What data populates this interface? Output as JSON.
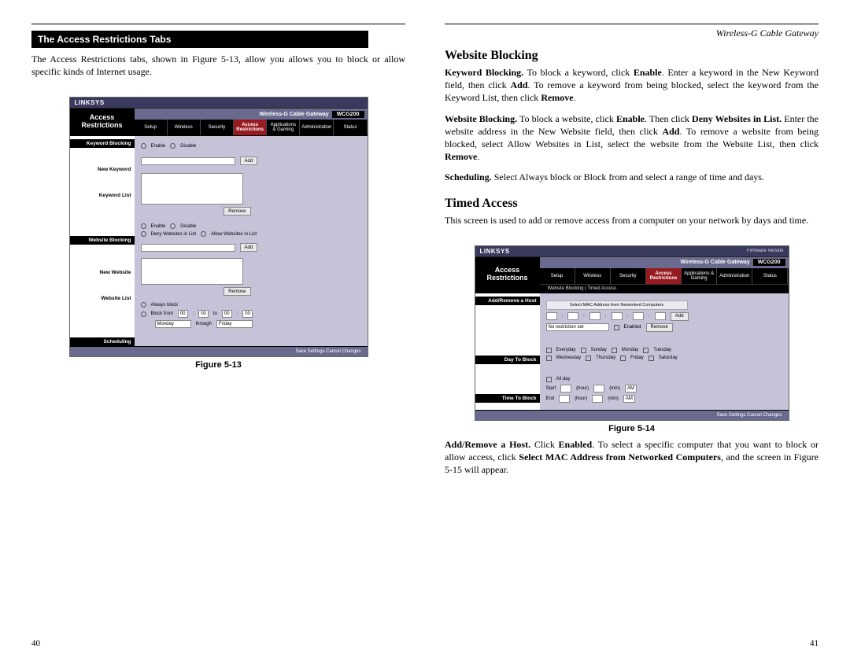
{
  "leftPage": {
    "sectionBar": "The Access Restrictions Tabs",
    "paragraph": "The Access Restrictions tabs, shown in Figure 5-13, allow you allows you to block or allow specific kinds of Internet usage.",
    "figCaption": "Figure 5-13",
    "pageNum": "40"
  },
  "rightPage": {
    "headerRight": "Wireless-G Cable Gateway",
    "h1a": "Website Blocking",
    "p1": "<b>Keyword Blocking.</b> To block a keyword, click <b>Enable</b>.  Enter a keyword in the New Keyword field, then click <b>Add</b>.  To remove a keyword from being blocked, select the keyword from the Keyword List, then click <b>Remove</b>.",
    "p2": "<b>Website Blocking.</b> To block a website, click <b>Enable</b>. Then click <b>Deny Websites in List.</b>  Enter the website address in the New Website field, then click <b>Add</b>. To remove a website from being blocked, select Allow Websites in List, select the website from the Website List, then click <b>Remove</b>.",
    "p3": "<b>Scheduling.</b> Select Always block or Block from and select a range of time and days.",
    "h1b": "Timed Access",
    "p4": "This screen is used to add or remove access from a computer on your network by days and time.",
    "figCaption": "Figure 5-14",
    "p5": "<b>Add/Remove a Host.</b> Click <b>Enabled</b>.  To select a specific computer that you want to block or allow access, click <b>Select MAC Address from Networked Computers</b>, and the screen in Figure 5-15 will appear.",
    "pageNum": "41"
  },
  "shot13": {
    "brand": "LINKSYS",
    "title": "Access Restrictions",
    "prod": "Wireless-G Cable Gateway",
    "model": "WCG200",
    "tabs": [
      "Setup",
      "Wireless",
      "Security",
      "Access Restrictions",
      "Applications & Gaming",
      "Administration",
      "Status"
    ],
    "sideLabels": [
      "Keyword Blocking",
      "New Keyword",
      "Keyword List",
      "Website Blocking",
      "New Website",
      "Website List",
      "Scheduling"
    ],
    "radios": {
      "enable": "Enable",
      "disable": "Disable",
      "deny": "Deny Websites in List",
      "allow": "Allow Websites in List",
      "always": "Always block",
      "blockfrom": "Block from"
    },
    "btnAdd": "Add",
    "btnRemove": "Remove",
    "sched": {
      "from": "Monday",
      "to": "through",
      "end": "Friday"
    },
    "footer": "Save Settings    Cancel Changes"
  },
  "shot14": {
    "brand": "LINKSYS",
    "fw": "Firmware Version",
    "title": "Access Restrictions",
    "prod": "Wireless-G Cable Gateway",
    "model": "WCG200",
    "tabs": [
      "Setup",
      "Wireless",
      "Security",
      "Access Restrictions",
      "Applications & Gaming",
      "Administration",
      "Status"
    ],
    "subtabs": "Website Blocking   |   Timed Access",
    "sideLabels": [
      "Add/Remove a Host",
      "Day To Block",
      "Time To Block"
    ],
    "msg": "Select MAC Address from Networked Computers",
    "btnAdd": "Add",
    "btnEnabled": "Enabled",
    "btnRemove": "Remove",
    "noRestrict": "No restriction set",
    "days": [
      "Everyday",
      "Sunday",
      "Monday",
      "Tuesday",
      "Wednesday",
      "Thursday",
      "Friday",
      "Saturday"
    ],
    "allDay": "All day",
    "start": "Start",
    "end": "End",
    "hour": "(hour)",
    "min": "(min)",
    "am": "AM",
    "footer": "Save Settings    Cancel Changes"
  }
}
